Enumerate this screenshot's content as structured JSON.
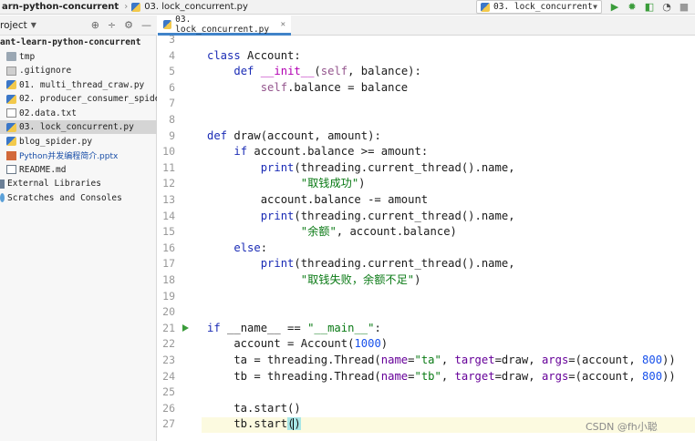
{
  "breadcrumb": {
    "project": "arn-python-concurrent",
    "file": "03. lock_concurrent.py"
  },
  "run_config": {
    "label": "03. lock_concurrent"
  },
  "toolbar_icons": [
    "run-icon",
    "debug-icon",
    "coverage-icon",
    "profile-icon",
    "stop-icon"
  ],
  "project_panel": {
    "title": "roject",
    "tree": [
      {
        "label": "ant-learn-python-concurrent",
        "kind": "root"
      },
      {
        "label": "tmp",
        "kind": "folder"
      },
      {
        "label": ".gitignore",
        "kind": "git"
      },
      {
        "label": "01. multi_thread_craw.py",
        "kind": "py"
      },
      {
        "label": "02. producer_consumer_spide",
        "kind": "py"
      },
      {
        "label": "02.data.txt",
        "kind": "txt"
      },
      {
        "label": "03. lock_concurrent.py",
        "kind": "py",
        "selected": true
      },
      {
        "label": "blog_spider.py",
        "kind": "py"
      },
      {
        "label": "Python并发编程简介.pptx",
        "kind": "ppt"
      },
      {
        "label": "README.md",
        "kind": "md"
      },
      {
        "label": "External Libraries",
        "kind": "lib"
      },
      {
        "label": "Scratches and Consoles",
        "kind": "scratch"
      }
    ]
  },
  "editor_tab": {
    "label": "03. lock_concurrent.py"
  },
  "code_lines": [
    {
      "n": "3",
      "html": ""
    },
    {
      "n": "4",
      "html": "<span class=\"kw\">class</span> Account:"
    },
    {
      "n": "5",
      "html": "    <span class=\"kw\">def</span> <span class=\"mg\">__init__</span>(<span class=\"self\">self</span>, balance):"
    },
    {
      "n": "6",
      "html": "        <span class=\"self\">self</span>.balance = balance"
    },
    {
      "n": "7",
      "html": ""
    },
    {
      "n": "8",
      "html": ""
    },
    {
      "n": "9",
      "html": "<span class=\"kw\">def</span> draw(account, amount):"
    },
    {
      "n": "10",
      "html": "    <span class=\"kw\">if</span> account.balance >= amount:"
    },
    {
      "n": "11",
      "html": "        <span class=\"kw\">print</span>(threading.current_thread().name,"
    },
    {
      "n": "12",
      "html": "              <span class=\"str\">\"取钱成功\"</span>)"
    },
    {
      "n": "13",
      "html": "        account.balance -= amount"
    },
    {
      "n": "14",
      "html": "        <span class=\"kw\">print</span>(threading.current_thread().name,"
    },
    {
      "n": "15",
      "html": "              <span class=\"str\">\"余额\"</span>, account.balance)"
    },
    {
      "n": "16",
      "html": "    <span class=\"kw\">else</span>:"
    },
    {
      "n": "17",
      "html": "        <span class=\"kw\">print</span>(threading.current_thread().name,"
    },
    {
      "n": "18",
      "html": "              <span class=\"str\">\"取钱失败，余额不足\"</span>)"
    },
    {
      "n": "19",
      "html": ""
    },
    {
      "n": "20",
      "html": ""
    },
    {
      "n": "21",
      "html": "<span class=\"kw\">if</span> __name__ == <span class=\"str\">\"__main__\"</span>:",
      "run": true
    },
    {
      "n": "22",
      "html": "    account = Account(<span class=\"num\">1000</span>)"
    },
    {
      "n": "23",
      "html": "    ta = threading.Thread(<span class=\"param\">name</span>=<span class=\"str\">\"ta\"</span>, <span class=\"param\">target</span>=draw, <span class=\"param\">args</span>=(account, <span class=\"num\">800</span>))"
    },
    {
      "n": "24",
      "html": "    tb = threading.Thread(<span class=\"param\">name</span>=<span class=\"str\">\"tb\"</span>, <span class=\"param\">target</span>=draw, <span class=\"param\">args</span>=(account, <span class=\"num\">800</span>))"
    },
    {
      "n": "25",
      "html": ""
    },
    {
      "n": "26",
      "html": "    ta.start()"
    },
    {
      "n": "27",
      "html": "    tb.start<span class=\"brace\">(</span><span class=\"caret\"></span><span class=\"brace\">)</span>",
      "current": true
    }
  ],
  "watermark": "CSDN @fh小聪",
  "colors": {
    "keyword": "#1a2bb5",
    "string": "#0a7a15",
    "number": "#1750eb",
    "self": "#94558d",
    "selection": "#d5d5d5",
    "tab_underline": "#4083c9"
  }
}
